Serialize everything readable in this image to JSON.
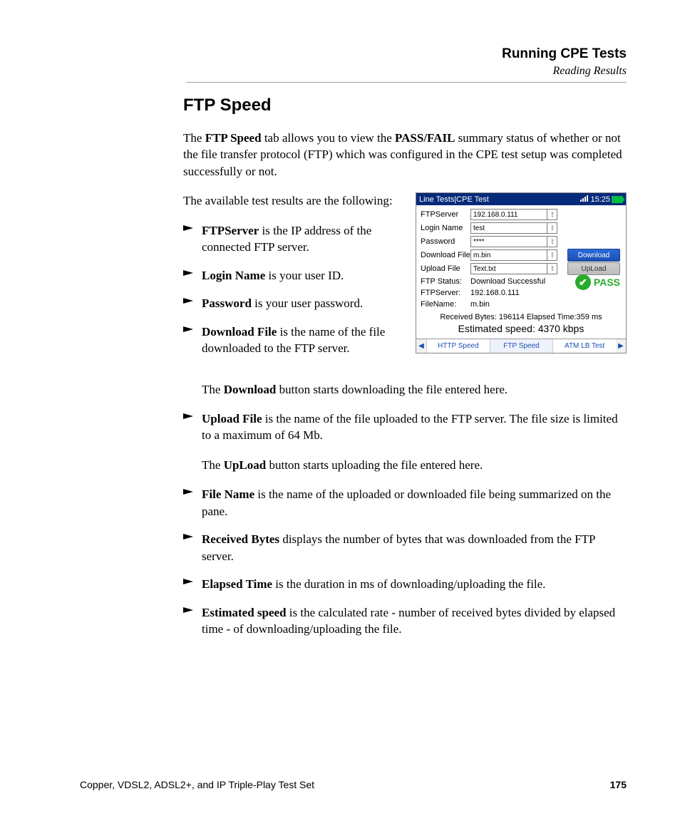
{
  "header": {
    "title": "Running CPE Tests",
    "subtitle": "Reading Results"
  },
  "section_title": "FTP Speed",
  "intro": {
    "p1_pre": "The ",
    "p1_b1": "FTP Speed",
    "p1_mid": " tab allows you to view the ",
    "p1_b2": "PASS/FAIL",
    "p1_post": " summary status of whether or not the file transfer protocol (FTP) which was configured in the CPE test setup was completed successfully or not.",
    "p2": "The available test results are the following:"
  },
  "device": {
    "titlebar": "Line Tests|CPE Test",
    "time": "15:25",
    "fields": {
      "ftpserver_label": "FTPServer",
      "ftpserver_value": "192.168.0.111",
      "login_label": "Login Name",
      "login_value": "test",
      "password_label": "Password",
      "password_value": "****",
      "download_file_label": "Download File",
      "download_file_value": "m.bin",
      "upload_file_label": "Upload File",
      "upload_file_value": "Text.txt"
    },
    "buttons": {
      "download": "Download",
      "upload": "UpLoad"
    },
    "status": {
      "ftp_status_label": "FTP Status:",
      "ftp_status_value": "Download Successful",
      "ftpserver_label": "FTPServer:",
      "ftpserver_value": "192.168.0.111",
      "filename_label": "FileName:",
      "filename_value": "m.bin"
    },
    "pass": "PASS",
    "received": "Received Bytes:  196114    Elapsed Time:359 ms",
    "estimated": "Estimated speed:  4370 kbps",
    "tabs": {
      "t1": "HTTP Speed",
      "t2": "FTP Speed",
      "t3": "ATM LB Test"
    }
  },
  "bullets": {
    "b1": {
      "bold": "FTPServer",
      "text": " is the IP address of the connected FTP server."
    },
    "b2": {
      "bold": "Login Name",
      "text": " is your user ID."
    },
    "b3": {
      "bold": "Password",
      "text": " is your user password."
    },
    "b4": {
      "bold": "Download File",
      "text": " is the name of the file downloaded to the FTP server."
    },
    "b4_sub_pre": "The ",
    "b4_sub_bold": "Download",
    "b4_sub_post": " button starts downloading the file entered here.",
    "b5": {
      "bold": "Upload File",
      "text": " is the name of the file uploaded to the FTP server. The file size is limited to a maximum of 64 Mb."
    },
    "b5_sub_pre": "The ",
    "b5_sub_bold": "UpLoad",
    "b5_sub_post": " button starts uploading the file entered here.",
    "b6": {
      "bold": "File Name",
      "text": " is the name of the uploaded or downloaded file being summarized on the pane."
    },
    "b7": {
      "bold": "Received Bytes",
      "text": " displays the number of bytes that was downloaded from the FTP server."
    },
    "b8": {
      "bold": "Elapsed Time",
      "text": " is the duration in ms of downloading/uploading the file."
    },
    "b9": {
      "bold": "Estimated speed",
      "text": " is the calculated rate - number of received bytes divided by elapsed time - of downloading/uploading the file."
    }
  },
  "footer": {
    "left": "Copper, VDSL2, ADSL2+, and IP Triple-Play Test Set",
    "page": "175"
  }
}
